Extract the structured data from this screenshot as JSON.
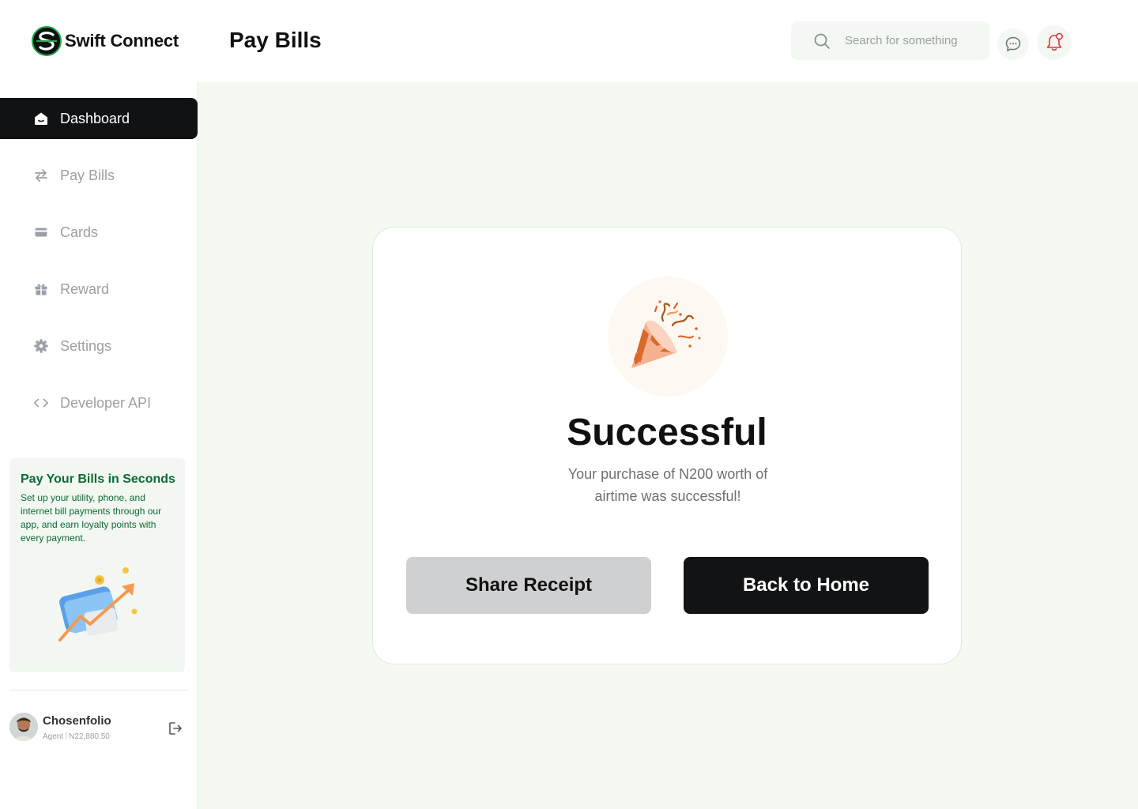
{
  "app": {
    "name": "Swift Connect"
  },
  "header": {
    "page_title": "Pay Bills",
    "search_placeholder": "Search for something"
  },
  "sidebar": {
    "items": [
      {
        "label": "Dashboard",
        "icon": "home-icon",
        "active": true
      },
      {
        "label": "Pay Bills",
        "icon": "transfer-arrows-icon",
        "active": false
      },
      {
        "label": "Cards",
        "icon": "card-icon",
        "active": false
      },
      {
        "label": "Reward",
        "icon": "gift-icon",
        "active": false
      },
      {
        "label": "Settings",
        "icon": "gear-icon",
        "active": false
      },
      {
        "label": "Developer API",
        "icon": "code-icon",
        "active": false
      }
    ],
    "promo": {
      "title": "Pay Your Bills in Seconds",
      "text": "Set up your utility, phone, and internet bill payments through our app, and earn loyalty points with every payment."
    },
    "profile": {
      "name": "Chosenfolio",
      "role": "Agent",
      "balance": "N22,880.50"
    }
  },
  "dialog": {
    "title": "Successful",
    "message": "Your purchase of N200 worth of airtime was successful!",
    "share_label": "Share Receipt",
    "home_label": "Back to Home"
  },
  "colors": {
    "accent_green": "#0c6a34",
    "active_nav": "#101214",
    "main_bg": "#f4f9f2",
    "notification_red": "#e0353b"
  }
}
